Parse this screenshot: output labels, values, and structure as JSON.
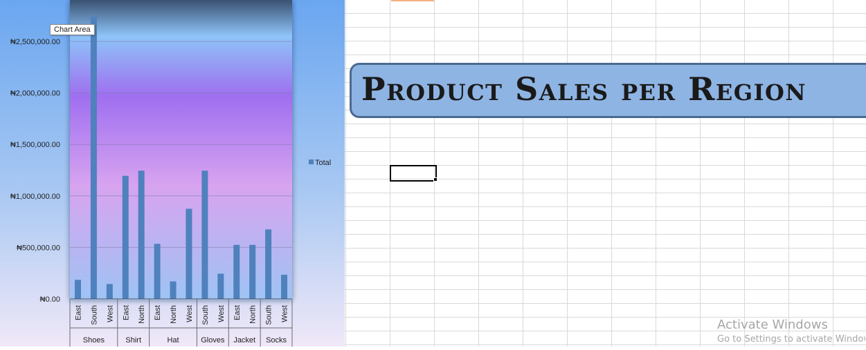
{
  "title_box": {
    "text": "Product Sales per Region"
  },
  "tooltip": {
    "text": "Chart Area"
  },
  "watermark": {
    "title": "Activate Windows",
    "subtitle": "Go to Settings to activate Windows."
  },
  "colors": {
    "bar": "#4f81bd",
    "grid": "#c8c8d8",
    "cell_cursor": "#000000",
    "title_fill": "#8eb4e3",
    "title_border": "#4a6a90"
  },
  "chart_data": {
    "type": "bar",
    "categories": [
      "East",
      "South",
      "West",
      "East",
      "North",
      "East",
      "North",
      "West",
      "South",
      "West",
      "East",
      "North",
      "South",
      "West"
    ],
    "groups": [
      {
        "label": "Shoes",
        "count": 3
      },
      {
        "label": "Shirt",
        "count": 2
      },
      {
        "label": "Hat",
        "count": 3
      },
      {
        "label": "Gloves",
        "count": 2
      },
      {
        "label": "Jacket",
        "count": 2
      },
      {
        "label": "Socks",
        "count": 2
      }
    ],
    "series": [
      {
        "name": "Total",
        "values": [
          185000,
          2740000,
          145000,
          1195000,
          1245000,
          535000,
          170000,
          875000,
          1245000,
          245000,
          525000,
          525000,
          675000,
          235000
        ]
      }
    ],
    "yticks": [
      "₦0.00",
      "₦500,000.00",
      "₦1,000,000.00",
      "₦1,500,000.00",
      "₦2,000,000.00",
      "₦2,500,000.00"
    ],
    "ylim": [
      0,
      2500000
    ],
    "grid": true,
    "legend_position": "right"
  }
}
